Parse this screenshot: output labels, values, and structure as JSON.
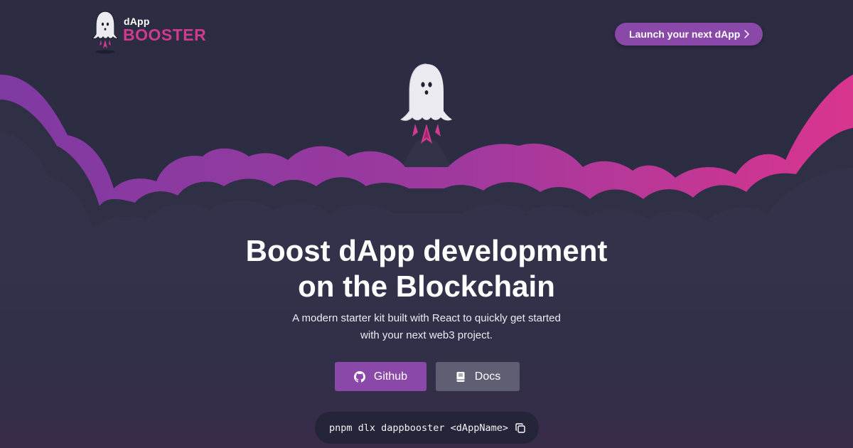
{
  "header": {
    "logo_small": "dApp",
    "logo_big": "BOOSTER",
    "launch_button_label": "Launch your next dApp",
    "launch_button_icon": "chevron-right-icon"
  },
  "hero": {
    "title_line1": "Boost dApp development",
    "title_line2": "on the Blockchain",
    "subtitle_line1": "A modern starter kit built with React to quickly get started",
    "subtitle_line2": "with your next web3 project."
  },
  "actions": {
    "github_label": "Github",
    "github_icon": "github-icon",
    "docs_label": "Docs",
    "docs_icon": "book-icon"
  },
  "install": {
    "command": "pnpm dlx dappbooster <dAppName>",
    "copy_icon": "copy-icon"
  },
  "colors": {
    "background": "#2b2b42",
    "accent_purple": "#8a48a8",
    "accent_pink": "#d13b8e",
    "docs_button": "#5f5e72",
    "command_bg": "#25253a"
  }
}
